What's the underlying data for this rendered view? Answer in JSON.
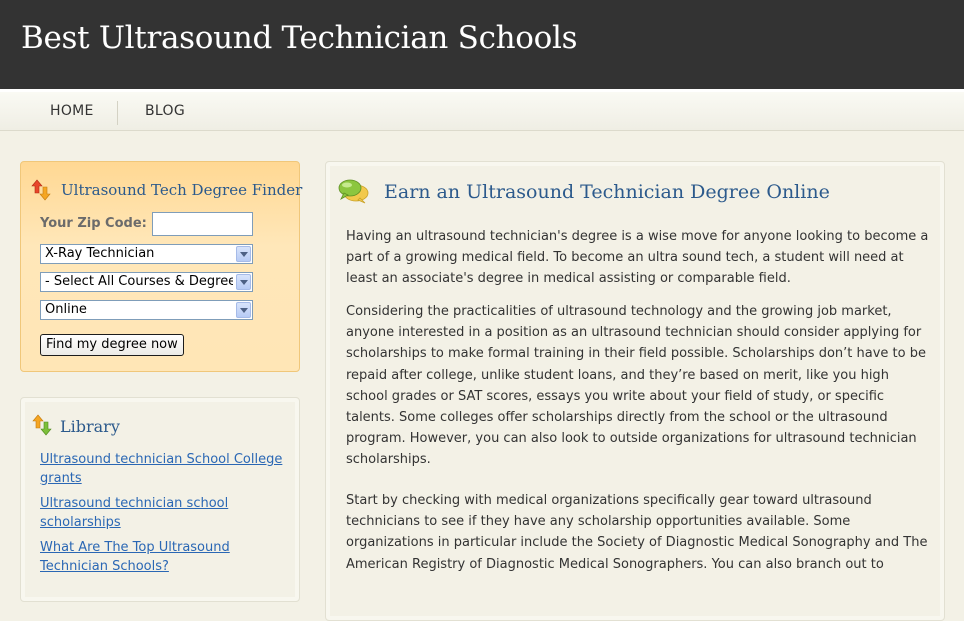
{
  "site": {
    "title": "Best Ultrasound Technician Schools"
  },
  "nav": {
    "items": [
      {
        "label": "HOME"
      },
      {
        "label": "BLOG"
      }
    ]
  },
  "finder": {
    "title": "Ultrasound Tech Degree Finder",
    "zip_label": "Your Zip Code:",
    "zip_value": "",
    "program_select": "X-Ray Technician",
    "courses_select": "- Select All Courses & Degrees -",
    "format_select": "Online",
    "submit_label": "Find my degree now"
  },
  "library": {
    "title": "Library",
    "links": [
      {
        "label": "Ultrasound technician School College grants"
      },
      {
        "label": "Ultrasound technician school scholarships"
      },
      {
        "label": "What Are The Top Ultrasound Technician Schools?"
      }
    ]
  },
  "article": {
    "title": "Earn an Ultrasound Technician Degree Online",
    "paragraphs": [
      "Having an ultrasound technician's degree is a wise move for anyone looking to become a part of a growing medical field. To become an ultra sound tech, a student will need at least an associate's degree in medical assisting or comparable field.",
      "Considering the practicalities of ultrasound technology and the growing job market, anyone interested in a position as an ultrasound technician should consider applying for scholarships to make formal training in their field possible. Scholarships don’t have to be repaid after college, unlike student loans, and they’re based on merit, like you high school grades or SAT scores, essays you write about your field of study, or specific talents. Some colleges offer scholarships directly from the school or the ultrasound program. However, you can also look to outside organizations for ultrasound technician scholarships.",
      "Start by checking with medical organizations specifically gear toward ultrasound technicians to see if they have any scholarship opportunities available. Some organizations in particular include the Society of Diagnostic Medical Sonography and The American Registry of Diagnostic Medical Sonographers. You can also branch out to"
    ]
  },
  "colors": {
    "header_bg": "#333333",
    "heading_blue": "#2c5a8c",
    "link_blue": "#2a67b4",
    "finder_bg": "#ffe6b6"
  },
  "icons": {
    "finder_icon": "up-down-arrows-icon",
    "library_icon": "up-down-arrows-icon",
    "article_icon": "speech-bubbles-icon"
  }
}
